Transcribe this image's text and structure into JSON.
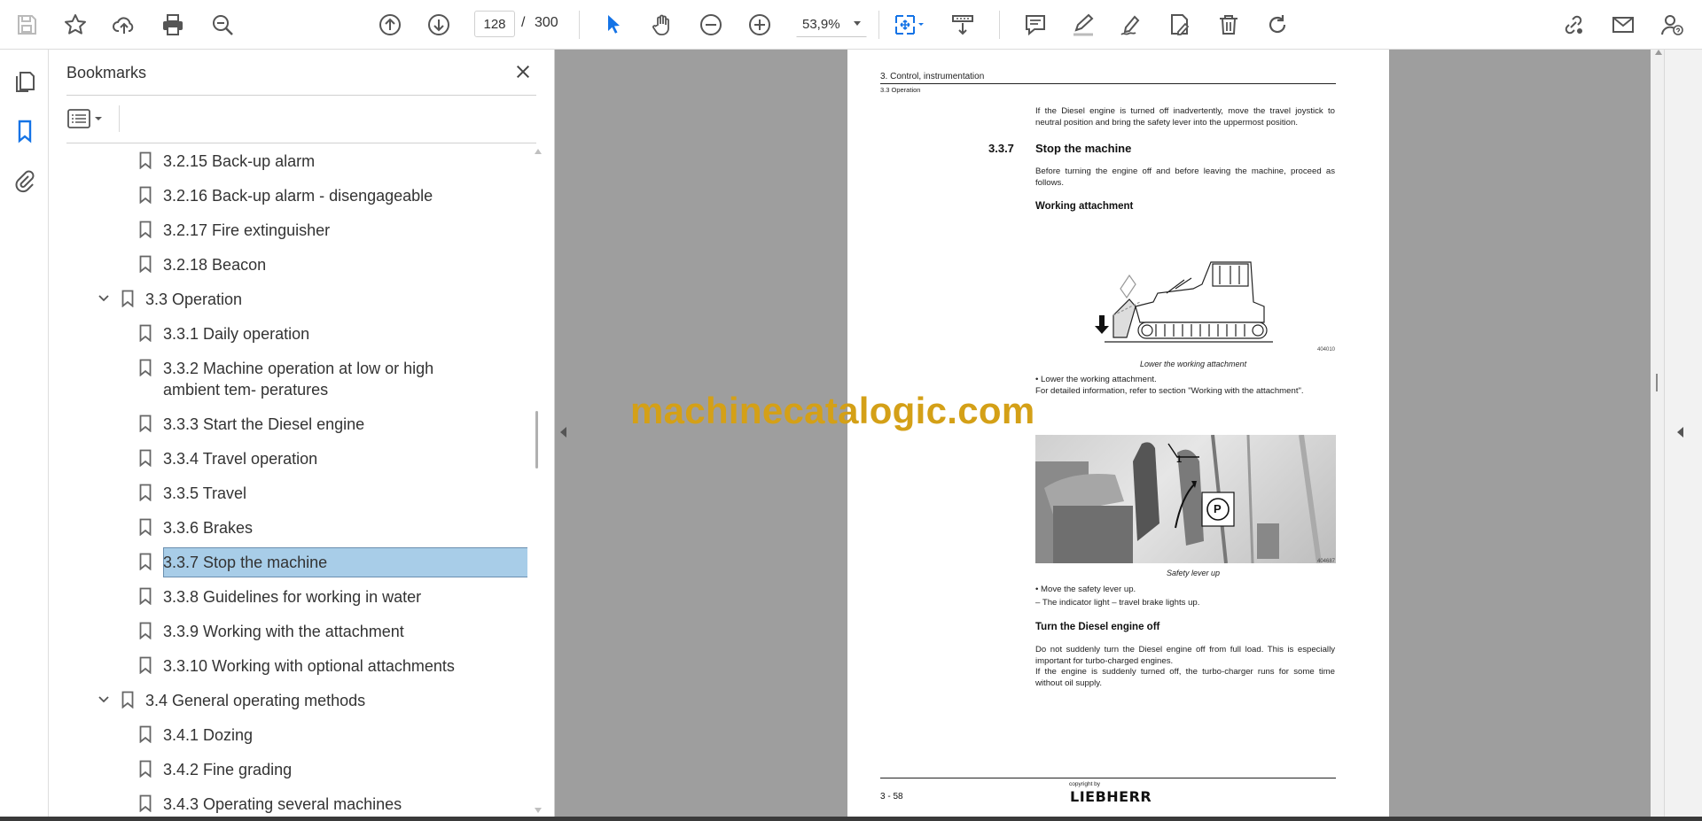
{
  "toolbar": {
    "page_current": "128",
    "page_separator": "/",
    "page_total": "300",
    "zoom": "53,9%"
  },
  "colors": {
    "selection": "#a8cde8",
    "accent": "#1473e6",
    "watermark": "#d4a017"
  },
  "panel": {
    "title": "Bookmarks",
    "items": [
      {
        "label": "3.2.15 Back-up alarm"
      },
      {
        "label": "3.2.16 Back-up alarm - disengageable"
      },
      {
        "label": "3.2.17 Fire extinguisher"
      },
      {
        "label": "3.2.18 Beacon"
      },
      {
        "label": "3.3 Operation"
      },
      {
        "label": "3.3.1 Daily operation"
      },
      {
        "label": "3.3.2 Machine operation at low or high ambient tem- peratures"
      },
      {
        "label": "3.3.3 Start the Diesel engine"
      },
      {
        "label": "3.3.4 Travel operation"
      },
      {
        "label": "3.3.5 Travel"
      },
      {
        "label": "3.3.6 Brakes"
      },
      {
        "label": "3.3.7 Stop the machine"
      },
      {
        "label": "3.3.8 Guidelines for working in water"
      },
      {
        "label": "3.3.9 Working with the attachment"
      },
      {
        "label": "3.3.10 Working with optional attachments"
      },
      {
        "label": "3.4 General operating methods"
      },
      {
        "label": "3.4.1 Dozing"
      },
      {
        "label": "3.4.2 Fine grading"
      },
      {
        "label": "3.4.3 Operating several machines"
      }
    ]
  },
  "document": {
    "header_chapter": "3. Control, instrumentation",
    "header_section": "3.3 Operation",
    "intro_para": "If the Diesel engine is turned off inadvertently, move the travel joystick to neutral position and bring the safety lever into the uppermost position.",
    "section_number": "3.3.7",
    "section_title": "Stop the machine",
    "section_intro": "Before turning the engine off and before leaving the machine, proceed as follows.",
    "sub1_title": "Working attachment",
    "fig1_code": "404010",
    "fig1_caption": "Lower the working attachment",
    "bullet1": "•  Lower the working attachment.",
    "bullet1_more": "For detailed information, refer to section \"Working with the attachment\".",
    "fig2_label_1": "1",
    "fig2_label_p": "P",
    "fig2_code": "404687",
    "fig2_caption": "Safety lever up",
    "bullet2": "•  Move the safety lever up.",
    "bullet3": "–   The indicator light – travel brake lights up.",
    "sub2_title": "Turn the Diesel engine off",
    "sub2_p1": "Do not suddenly turn the Diesel engine off from full load. This is especially important for turbo-charged engines.",
    "sub2_p2": "If the engine is suddenly turned off, the turbo-charger runs for some time without oil supply.",
    "footer_copyright": "copyright by",
    "footer_page": "3 - 58",
    "footer_logo": "LIEBHERR"
  },
  "watermark": "machinecatalogic.com"
}
